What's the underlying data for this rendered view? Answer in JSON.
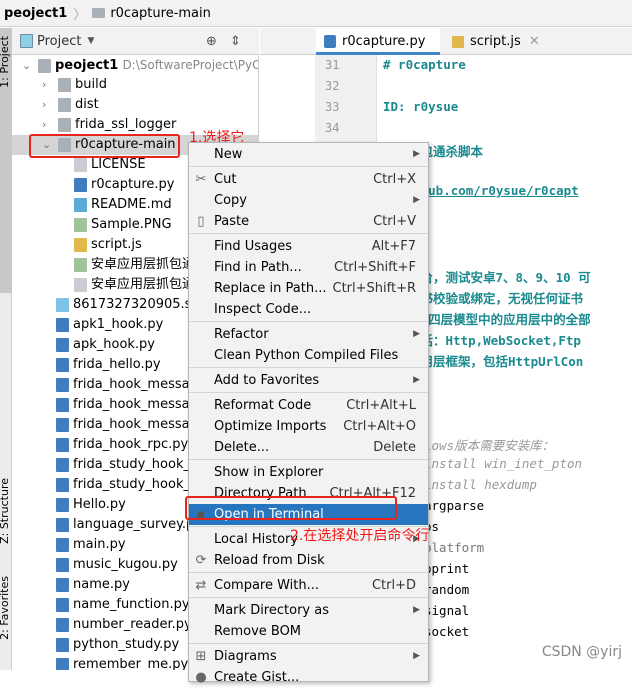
{
  "breadcrumb": {
    "project": "peoject1",
    "folder": "r0capture-main"
  },
  "side_stripe": {
    "project_tab": "1: Project",
    "structure_tab": "Z: Structure",
    "favorites_tab": "2: Favorites"
  },
  "project_panel": {
    "title": "Project"
  },
  "tree": [
    {
      "label": "peoject1",
      "path": "D:\\SoftwareProject\\PyCharmProjec",
      "type": "folder",
      "expanded": true,
      "depth": 0
    },
    {
      "label": "build",
      "type": "folder",
      "depth": 1
    },
    {
      "label": "dist",
      "type": "folder",
      "depth": 1
    },
    {
      "label": "frida_ssl_logger",
      "type": "folder",
      "depth": 1
    },
    {
      "label": "r0capture-main",
      "type": "folder",
      "expanded": true,
      "depth": 1,
      "selected": true
    },
    {
      "label": "LICENSE",
      "type": "text",
      "depth": 2
    },
    {
      "label": "r0capture.py",
      "type": "py",
      "depth": 2
    },
    {
      "label": "README.md",
      "type": "md",
      "depth": 2
    },
    {
      "label": "Sample.PNG",
      "type": "img",
      "depth": 2
    },
    {
      "label": "script.js",
      "type": "js",
      "depth": 2
    },
    {
      "label": "安卓应用层抓包通",
      "type": "img",
      "depth": 2
    },
    {
      "label": "安卓应用层抓包通",
      "type": "text",
      "depth": 2
    },
    {
      "label": "8617327320905.ses",
      "type": "db",
      "depth": 1
    },
    {
      "label": "apk1_hook.py",
      "type": "py",
      "depth": 1
    },
    {
      "label": "apk_hook.py",
      "type": "py",
      "depth": 1
    },
    {
      "label": "frida_hello.py",
      "type": "py",
      "depth": 1
    },
    {
      "label": "frida_hook_messag",
      "type": "py",
      "depth": 1
    },
    {
      "label": "frida_hook_messag",
      "type": "py",
      "depth": 1
    },
    {
      "label": "frida_hook_messag",
      "type": "py",
      "depth": 1
    },
    {
      "label": "frida_hook_rpc.py",
      "type": "py",
      "depth": 1
    },
    {
      "label": "frida_study_hook_ja",
      "type": "py",
      "depth": 1
    },
    {
      "label": "frida_study_hook_ja",
      "type": "py",
      "depth": 1
    },
    {
      "label": "Hello.py",
      "type": "py",
      "depth": 1
    },
    {
      "label": "language_survey.py",
      "type": "py",
      "depth": 1
    },
    {
      "label": "main.py",
      "type": "py",
      "depth": 1
    },
    {
      "label": "music_kugou.py",
      "type": "py",
      "depth": 1
    },
    {
      "label": "name.py",
      "type": "py",
      "depth": 1
    },
    {
      "label": "name_function.py",
      "type": "py",
      "depth": 1
    },
    {
      "label": "number_reader.py",
      "type": "py",
      "depth": 1
    },
    {
      "label": "python_study.py",
      "type": "py",
      "depth": 1
    },
    {
      "label": "remember_me.py",
      "type": "py",
      "depth": 1
    }
  ],
  "tabs": [
    {
      "label": "r0capture.py",
      "active": true
    },
    {
      "label": "script.js",
      "active": false
    }
  ],
  "line_numbers": [
    "31",
    "32",
    "33",
    "34"
  ],
  "code_lines": [
    {
      "text": "# r0capture",
      "style": "h"
    },
    {
      "text": "",
      "style": "h"
    },
    {
      "text": "ID: r0ysue",
      "style": "h"
    },
    {
      "text": "",
      "style": "h"
    },
    {
      "text": "用层抓包通杀脚本",
      "style": "h"
    },
    {
      "text": "",
      "style": "h"
    },
    {
      "text": "//github.com/r0ysue/r0capt",
      "style": "h"
    },
    {
      "text": "",
      "style": "h"
    },
    {
      "text": "`",
      "style": "h"
    },
    {
      "text": "",
      "style": "h"
    },
    {
      "text": "安卓平台，测试安卓7、8、9、10 可",
      "style": "h"
    },
    {
      "text": "所有证书校验或绑定，无视任何证书",
      "style": "h"
    },
    {
      "text": "TCP/IP四层模型中的应用层中的全部",
      "style": "h"
    },
    {
      "text": "协议包括：Http,WebSocket,Ftp",
      "style": "h"
    },
    {
      "text": "所有应用层框架，包括HttpUrlCon",
      "style": "h"
    },
    {
      "text": "",
      "style": "h"
    },
    {
      "text": "",
      "style": "h"
    },
    {
      "text": "",
      "style": "h"
    },
    {
      "text": "lows版本需要安装库：",
      "style": "c"
    },
    {
      "text": " install win_inet_pton",
      "style": "c"
    },
    {
      "text": " install hexdump",
      "style": "c"
    },
    {
      "text": "  argparse",
      "style": "n"
    },
    {
      "text": "  os",
      "style": "n"
    },
    {
      "text": "  platform",
      "style": "g"
    },
    {
      "text": "  pprint",
      "style": "n"
    },
    {
      "text": "  random",
      "style": "n"
    },
    {
      "text": "  signal",
      "style": "n"
    },
    {
      "text": "  socket",
      "style": "n"
    }
  ],
  "context_menu": [
    {
      "label": "New",
      "submenu": true
    },
    {
      "sep": true
    },
    {
      "label": "Cut",
      "shortcut": "Ctrl+X",
      "icon": "scissors"
    },
    {
      "label": "Copy",
      "submenu": true
    },
    {
      "label": "Paste",
      "shortcut": "Ctrl+V",
      "icon": "clipboard"
    },
    {
      "sep": true
    },
    {
      "label": "Find Usages",
      "shortcut": "Alt+F7"
    },
    {
      "label": "Find in Path...",
      "shortcut": "Ctrl+Shift+F"
    },
    {
      "label": "Replace in Path...",
      "shortcut": "Ctrl+Shift+R"
    },
    {
      "label": "Inspect Code..."
    },
    {
      "sep": true
    },
    {
      "label": "Refactor",
      "submenu": true
    },
    {
      "label": "Clean Python Compiled Files"
    },
    {
      "sep": true
    },
    {
      "label": "Add to Favorites",
      "submenu": true
    },
    {
      "sep": true
    },
    {
      "label": "Reformat Code",
      "shortcut": "Ctrl+Alt+L"
    },
    {
      "label": "Optimize Imports",
      "shortcut": "Ctrl+Alt+O"
    },
    {
      "label": "Delete...",
      "shortcut": "Delete"
    },
    {
      "sep": true
    },
    {
      "label": "Show in Explorer"
    },
    {
      "label": "Directory Path",
      "shortcut": "Ctrl+Alt+F12"
    },
    {
      "label": "Open in Terminal",
      "icon": "terminal",
      "highlighted": true
    },
    {
      "sep": true
    },
    {
      "label": "Local History",
      "submenu": true
    },
    {
      "label": "Reload from Disk",
      "icon": "reload"
    },
    {
      "sep": true
    },
    {
      "label": "Compare With...",
      "shortcut": "Ctrl+D",
      "icon": "compare"
    },
    {
      "sep": true
    },
    {
      "label": "Mark Directory as",
      "submenu": true
    },
    {
      "label": "Remove BOM"
    },
    {
      "sep": true
    },
    {
      "label": "Diagrams",
      "submenu": true,
      "icon": "diagram"
    },
    {
      "label": "Create Gist...",
      "icon": "github"
    }
  ],
  "annotations": {
    "step1": "1.选择它",
    "step2": "2.在选择处开启命令行"
  },
  "watermark": "CSDN @yirj",
  "colors": {
    "highlight": "#2675bf",
    "annotation": "#e8241d",
    "code": "#1b8a8f"
  }
}
